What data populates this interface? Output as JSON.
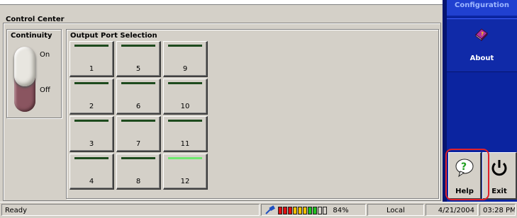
{
  "control_center": {
    "title": "Control Center",
    "continuity": {
      "title": "Continuity",
      "on_label": "On",
      "off_label": "Off"
    },
    "output_ports": {
      "title": "Output Port Selection",
      "ports": [
        {
          "num": "1",
          "active": false
        },
        {
          "num": "5",
          "active": false
        },
        {
          "num": "9",
          "active": false
        },
        {
          "num": "2",
          "active": false
        },
        {
          "num": "6",
          "active": false
        },
        {
          "num": "10",
          "active": false
        },
        {
          "num": "3",
          "active": false
        },
        {
          "num": "7",
          "active": false
        },
        {
          "num": "11",
          "active": false
        },
        {
          "num": "4",
          "active": false
        },
        {
          "num": "8",
          "active": false
        },
        {
          "num": "12",
          "active": true
        }
      ]
    }
  },
  "right_panel": {
    "configuration_label": "Configuration",
    "about_label": "About",
    "about_icon": "book-question-icon",
    "help_label": "Help",
    "help_icon": "question-bubble-icon",
    "exit_label": "Exit",
    "exit_icon": "power-icon"
  },
  "statusbar": {
    "status": "Ready",
    "signal_percent": "84%",
    "signal_value": 0.84,
    "location": "Local",
    "date": "4/21/2004",
    "time": "03:28 PM"
  },
  "colors": {
    "panel_blue": "#0b24a0",
    "led_on": "#6fe86f",
    "led_off": "#1d4a1d",
    "highlight": "#e0202a"
  }
}
